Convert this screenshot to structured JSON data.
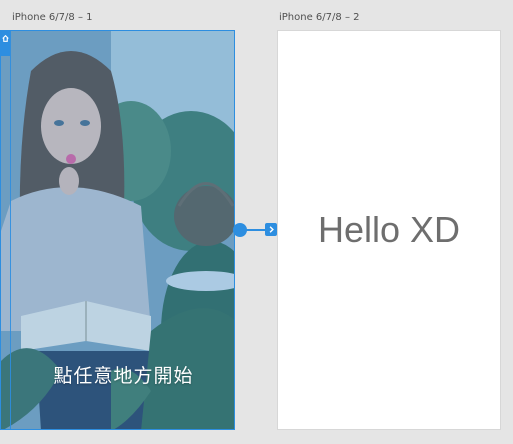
{
  "artboards": [
    {
      "label": "iPhone 6/7/8 – 1"
    },
    {
      "label": "iPhone 6/7/8 – 2"
    }
  ],
  "artboard1": {
    "photo": "girl-reading-book-in-garden",
    "caption": "點任意地方開始"
  },
  "artboard2": {
    "heading": "Hello XD"
  },
  "colors": {
    "canvas": "#e5e5e5",
    "selection": "#2d8ee0",
    "artboard_bg": "#ffffff",
    "heading_text": "#6e6e6e"
  },
  "icons": {
    "home_tab": "home-icon",
    "wire_target": "chevron-right-icon"
  }
}
